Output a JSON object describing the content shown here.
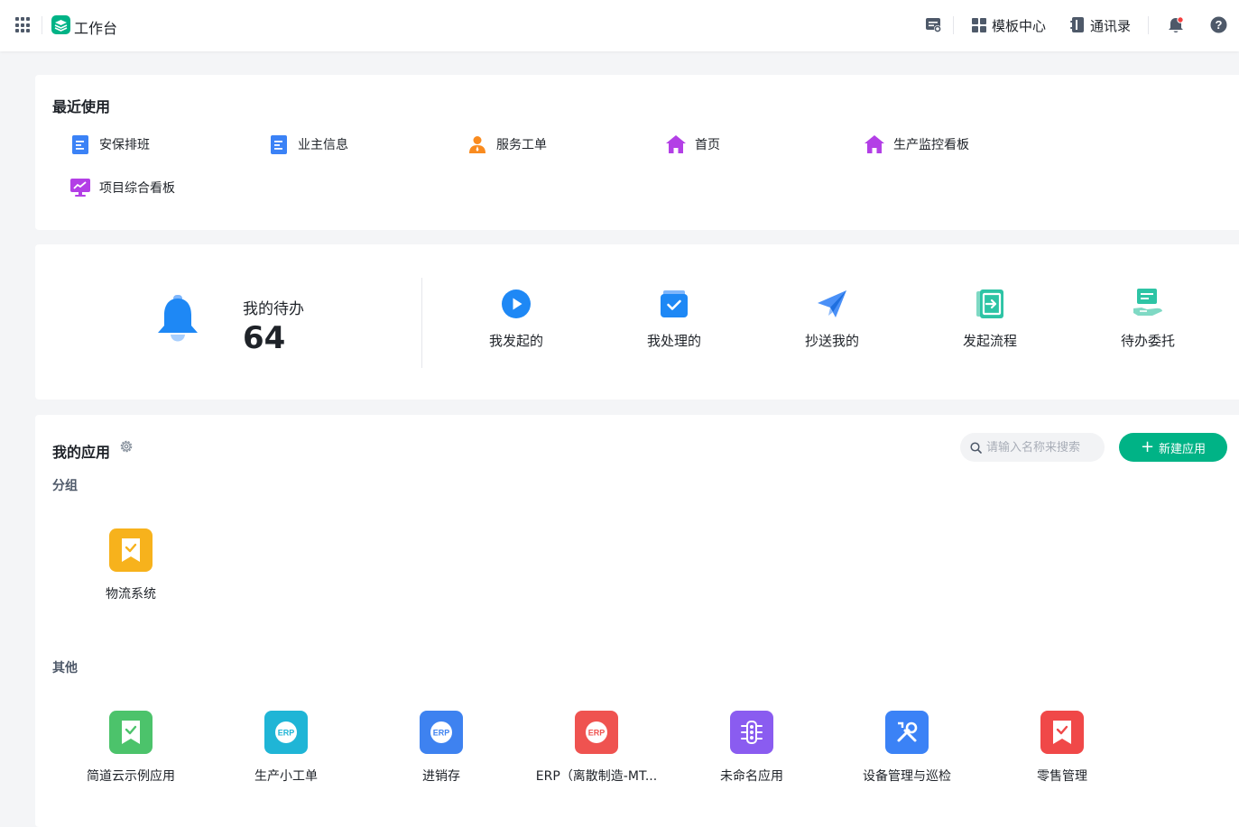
{
  "topbar": {
    "title": "工作台",
    "template_center": "模板中心",
    "contacts": "通讯录"
  },
  "recent": {
    "title": "最近使用",
    "items": [
      {
        "label": "安保排班",
        "icon": "document-icon"
      },
      {
        "label": "业主信息",
        "icon": "document-icon"
      },
      {
        "label": "服务工单",
        "icon": "person-icon"
      },
      {
        "label": "首页",
        "icon": "home-icon"
      },
      {
        "label": "生产监控看板",
        "icon": "home-icon"
      },
      {
        "label": "项目综合看板",
        "icon": "monitor-icon"
      }
    ]
  },
  "todo": {
    "label": "我的待办",
    "count": "64",
    "actions": [
      {
        "label": "我发起的",
        "icon": "play-icon"
      },
      {
        "label": "我处理的",
        "icon": "check-box-icon"
      },
      {
        "label": "抄送我的",
        "icon": "paper-plane-icon"
      },
      {
        "label": "发起流程",
        "icon": "enter-icon"
      },
      {
        "label": "待办委托",
        "icon": "handover-icon"
      }
    ]
  },
  "apps": {
    "title": "我的应用",
    "search_placeholder": "请输入名称来搜索",
    "new_app": "新建应用",
    "groups": [
      {
        "name": "分组",
        "items": [
          {
            "label": "物流系统",
            "color": "#f7b21c"
          }
        ]
      },
      {
        "name": "其他",
        "items": [
          {
            "label": "简道云示例应用",
            "color": "#4cc36b"
          },
          {
            "label": "生产小工单",
            "color": "#1fb5d6"
          },
          {
            "label": "进销存",
            "color": "#3e82f0"
          },
          {
            "label": "ERP（离散制造-MT...",
            "color": "#ef5350"
          },
          {
            "label": "未命名应用",
            "color": "#8a5cf0"
          },
          {
            "label": "设备管理与巡检",
            "color": "#3b82f6"
          },
          {
            "label": "零售管理",
            "color": "#f04848"
          }
        ]
      }
    ]
  },
  "colors": {
    "accent": "#00b386",
    "primary_blue": "#1e88f5",
    "purple": "#b33fe6",
    "bell_red": "#f53f3f"
  }
}
